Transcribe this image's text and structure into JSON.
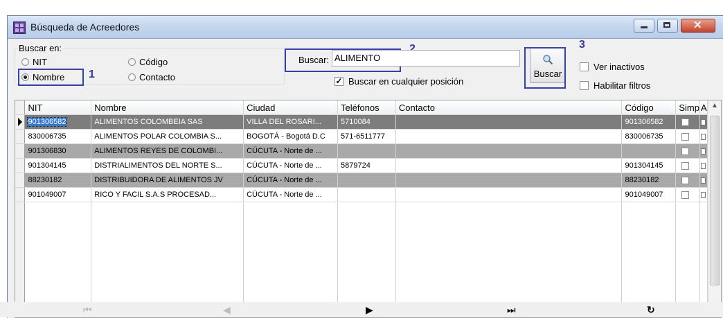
{
  "window": {
    "title": "Búsqueda de Acreedores"
  },
  "search_group": {
    "legend": "Buscar en:",
    "options": [
      {
        "label": "NIT",
        "selected": false
      },
      {
        "label": "Nombre",
        "selected": true
      },
      {
        "label": "Código",
        "selected": false
      },
      {
        "label": "Contacto",
        "selected": false
      }
    ]
  },
  "annotations": {
    "one": "1",
    "two": "2",
    "three": "3"
  },
  "search": {
    "label": "Buscar:",
    "value": "ALIMENTO",
    "anywhere_label": "Buscar en cualquier posición",
    "anywhere_checked": true,
    "button_label": "Buscar"
  },
  "filters": {
    "inactive_label": "Ver inactivos",
    "inactive_checked": false,
    "filters_label": "Habilitar filtros",
    "filters_checked": false
  },
  "grid": {
    "columns": [
      "NIT",
      "Nombre",
      "Ciudad",
      "Teléfonos",
      "Contacto",
      "Código",
      "Simp",
      "A"
    ],
    "rows": [
      {
        "nit": "901306582",
        "nombre": "ALIMENTOS COLOMBEIA SAS",
        "ciudad": "VILLA DEL ROSARI...",
        "telefonos": "5710084",
        "contacto": "",
        "codigo": "901306582"
      },
      {
        "nit": "830006735",
        "nombre": "ALIMENTOS POLAR COLOMBIA S...",
        "ciudad": "BOGOTÁ - Bogotá D.C",
        "telefonos": "571-6511777",
        "contacto": "",
        "codigo": "830006735"
      },
      {
        "nit": "901306830",
        "nombre": "ALIMENTOS REYES DE COLOMBI...",
        "ciudad": "CÚCUTA - Norte de ...",
        "telefonos": "",
        "contacto": "",
        "codigo": ""
      },
      {
        "nit": "901304145",
        "nombre": "DISTRIALIMENTOS DEL NORTE S...",
        "ciudad": "CÚCUTA - Norte de ...",
        "telefonos": "5879724",
        "contacto": "",
        "codigo": "901304145"
      },
      {
        "nit": "88230182",
        "nombre": "DISTRIBUIDORA DE ALIMENTOS JV",
        "ciudad": "CÚCUTA - Norte de ...",
        "telefonos": "",
        "contacto": "",
        "codigo": "88230182"
      },
      {
        "nit": "901049007",
        "nombre": "RICO Y FACIL S.A.S PROCESAD...",
        "ciudad": "CÚCUTA - Norte de ...",
        "telefonos": "",
        "contacto": "",
        "codigo": "901049007"
      }
    ]
  },
  "colors": {
    "annotation": "#3341b8",
    "row_dark": "#a9a9a9",
    "row_selected": "#7d7d7d",
    "selection": "#3478d6"
  },
  "icons": {
    "search_button": "search-icon",
    "nav": [
      "first-icon",
      "prev-icon",
      "next-icon",
      "last-icon",
      "refresh-icon"
    ]
  }
}
